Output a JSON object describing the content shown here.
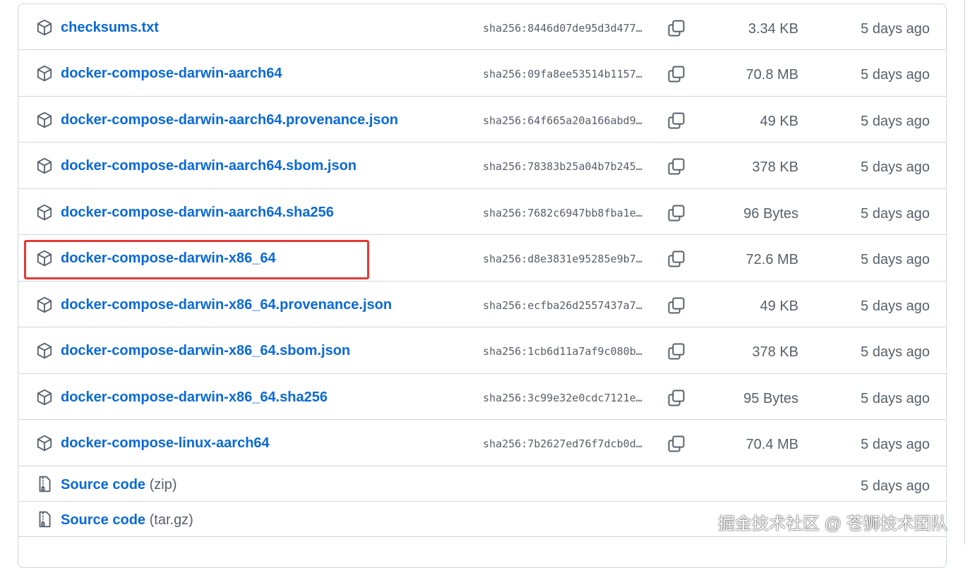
{
  "assets": [
    {
      "name": "checksums.txt",
      "sha": "sha256:8446d07de95d3d477…",
      "size": "3.34 KB",
      "date": "5 days ago"
    },
    {
      "name": "docker-compose-darwin-aarch64",
      "sha": "sha256:09fa8ee53514b1157…",
      "size": "70.8 MB",
      "date": "5 days ago"
    },
    {
      "name": "docker-compose-darwin-aarch64.provenance.json",
      "sha": "sha256:64f665a20a166abd9…",
      "size": "49 KB",
      "date": "5 days ago"
    },
    {
      "name": "docker-compose-darwin-aarch64.sbom.json",
      "sha": "sha256:78383b25a04b7b245…",
      "size": "378 KB",
      "date": "5 days ago"
    },
    {
      "name": "docker-compose-darwin-aarch64.sha256",
      "sha": "sha256:7682c6947bb8fba1e…",
      "size": "96 Bytes",
      "date": "5 days ago"
    },
    {
      "name": "docker-compose-darwin-x86_64",
      "sha": "sha256:d8e3831e95285e9b7…",
      "size": "72.6 MB",
      "date": "5 days ago",
      "highlighted": true
    },
    {
      "name": "docker-compose-darwin-x86_64.provenance.json",
      "sha": "sha256:ecfba26d2557437a7…",
      "size": "49 KB",
      "date": "5 days ago"
    },
    {
      "name": "docker-compose-darwin-x86_64.sbom.json",
      "sha": "sha256:1cb6d11a7af9c080b…",
      "size": "378 KB",
      "date": "5 days ago"
    },
    {
      "name": "docker-compose-darwin-x86_64.sha256",
      "sha": "sha256:3c99e32e0cdc7121e…",
      "size": "95 Bytes",
      "date": "5 days ago"
    },
    {
      "name": "docker-compose-linux-aarch64",
      "sha": "sha256:7b2627ed76f7dcb0d…",
      "size": "70.4 MB",
      "date": "5 days ago"
    }
  ],
  "source": [
    {
      "label": "Source code",
      "ext": "(zip)",
      "date": "5 days ago"
    },
    {
      "label": "Source code",
      "ext": "(tar.gz)",
      "date": ""
    }
  ],
  "icons": {
    "asset": "package-icon",
    "copy": "copy-icon",
    "source": "file-zip-icon"
  },
  "colors": {
    "link": "#0969da",
    "muted": "#57606a",
    "border": "#d0d7de",
    "highlight": "#e53935"
  },
  "watermark": "掘金技术社区 @ 苍狮技术团队"
}
